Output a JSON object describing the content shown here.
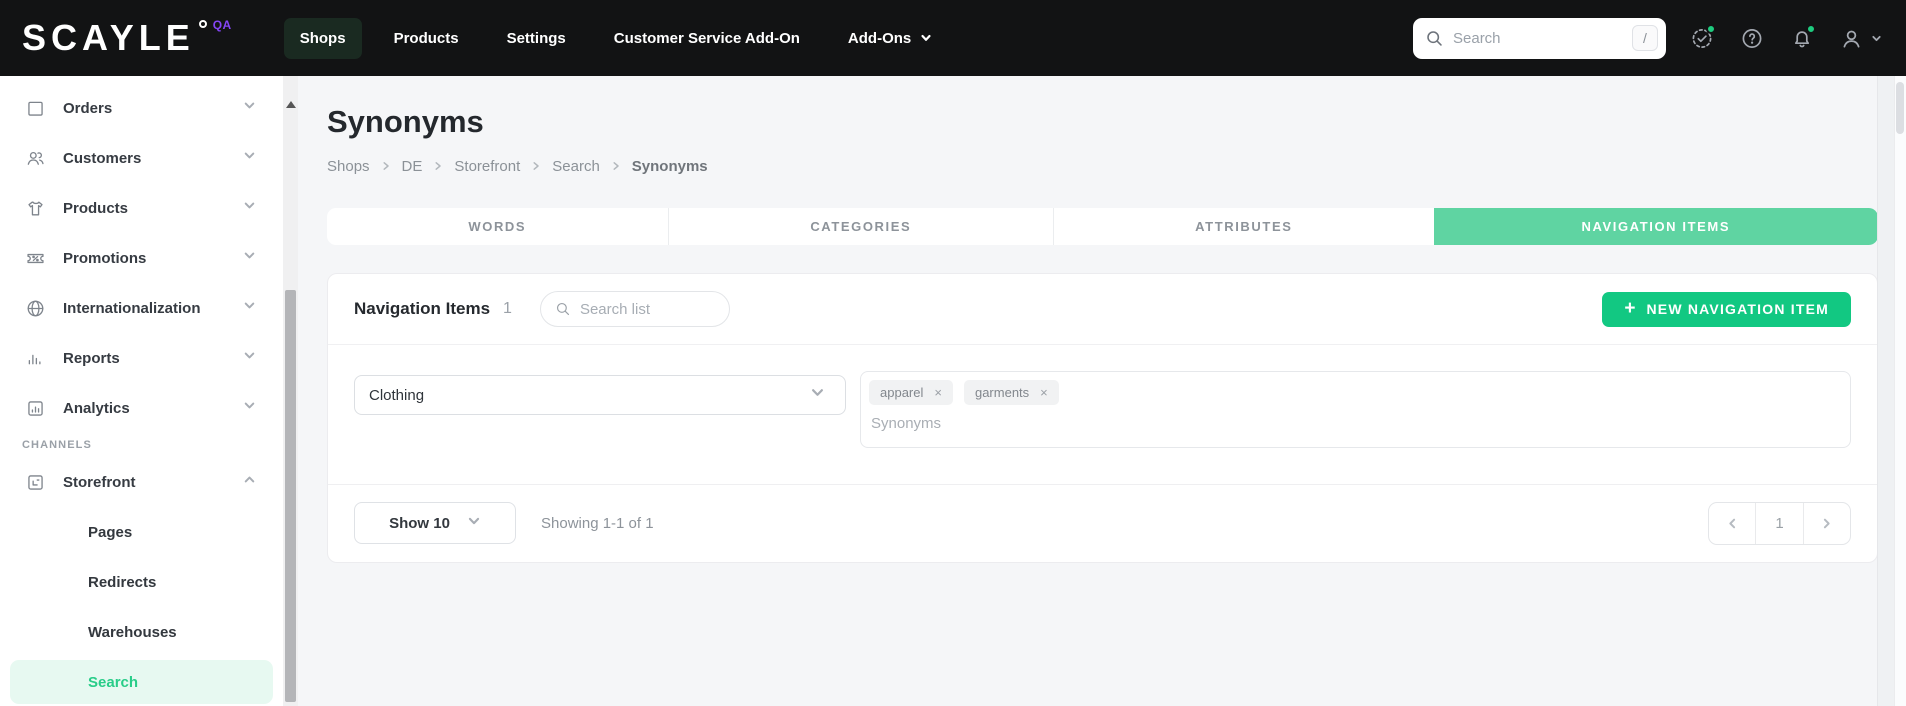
{
  "colors": {
    "topbar_bg": "#121314",
    "accent_button_green": "#12c882",
    "tab_active_green": "#5fd4a2",
    "sidebar_active_bg": "#e7f9f1",
    "sidebar_active_text": "#29cd89",
    "qa_badge_purple": "#8445f6",
    "notification_dot_green": "#1ecb7f"
  },
  "topbar": {
    "logo": "SCAYLE",
    "qa_badge": "QA",
    "nav": [
      {
        "label": "Shops",
        "active": true
      },
      {
        "label": "Products",
        "active": false
      },
      {
        "label": "Settings",
        "active": false
      },
      {
        "label": "Customer Service Add-On",
        "active": false
      },
      {
        "label": "Add-Ons",
        "active": false,
        "has_chevron": true
      }
    ],
    "search": {
      "placeholder": "Search",
      "shortcut": "/"
    },
    "icons": [
      "status-check-icon",
      "help-icon",
      "notifications-bell-icon",
      "user-icon"
    ]
  },
  "sidebar": {
    "items": [
      {
        "label": "Orders",
        "icon": "box-icon"
      },
      {
        "label": "Customers",
        "icon": "people-icon"
      },
      {
        "label": "Products",
        "icon": "tshirt-icon"
      },
      {
        "label": "Promotions",
        "icon": "ticket-percent-icon"
      },
      {
        "label": "Internationalization",
        "icon": "globe-icon"
      },
      {
        "label": "Reports",
        "icon": "bar-chart-icon"
      },
      {
        "label": "Analytics",
        "icon": "analytics-panel-icon"
      }
    ],
    "section_label": "CHANNELS",
    "storefront": {
      "label": "Storefront",
      "icon": "storefront-window-icon",
      "expanded": true
    },
    "sub_items": [
      {
        "label": "Pages",
        "active": false
      },
      {
        "label": "Redirects",
        "active": false
      },
      {
        "label": "Warehouses",
        "active": false
      },
      {
        "label": "Search",
        "active": true
      }
    ]
  },
  "page": {
    "title": "Synonyms",
    "breadcrumb": [
      {
        "label": "Shops"
      },
      {
        "label": "DE"
      },
      {
        "label": "Storefront"
      },
      {
        "label": "Search"
      },
      {
        "label": "Synonyms",
        "current": true
      }
    ],
    "tabs": [
      {
        "label": "WORDS",
        "active": false
      },
      {
        "label": "CATEGORIES",
        "active": false
      },
      {
        "label": "ATTRIBUTES",
        "active": false
      },
      {
        "label": "NAVIGATION ITEMS",
        "active": true
      }
    ]
  },
  "panel": {
    "title": "Navigation Items",
    "count": "1",
    "search_placeholder": "Search list",
    "new_button": {
      "plus": "+",
      "label": "NEW NAVIGATION ITEM"
    },
    "row": {
      "category_value": "Clothing",
      "tags": [
        {
          "label": "apparel",
          "remove": "×"
        },
        {
          "label": "garments",
          "remove": "×"
        }
      ],
      "synonyms_placeholder": "Synonyms"
    },
    "footer": {
      "show_label": "Show 10",
      "summary": "Showing 1-1 of 1",
      "page_number": "1"
    }
  }
}
